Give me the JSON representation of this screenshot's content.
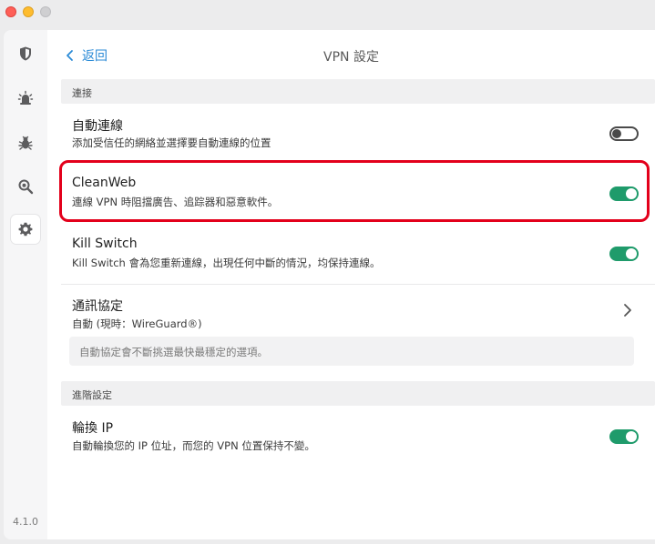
{
  "app": {
    "version": "4.1.0",
    "sidebar": [
      {
        "icon": "shield-icon",
        "active": false
      },
      {
        "icon": "alarm-light-icon",
        "active": false
      },
      {
        "icon": "bug-icon",
        "active": false
      },
      {
        "icon": "search-bug-icon",
        "active": false
      },
      {
        "icon": "gear-icon",
        "active": true
      }
    ]
  },
  "header": {
    "back_label": "返回",
    "title": "VPN 設定"
  },
  "sections": {
    "connect_header": "連接",
    "advanced_header": "進階設定"
  },
  "settings": {
    "auto_connect": {
      "title": "自動連線",
      "subtitle": "添加受信任的網絡並選擇要自動連線的位置",
      "enabled": false
    },
    "cleanweb": {
      "title": "CleanWeb",
      "subtitle": "連線 VPN 時阻擋廣告、追踪器和惡意軟件。",
      "enabled": true
    },
    "kill_switch": {
      "title": "Kill Switch",
      "subtitle": "Kill Switch 會為您重新連線，出現任何中斷的情況，均保持連線。",
      "enabled": true
    },
    "protocol": {
      "title": "通訊協定",
      "subtitle": "自動 (現時：WireGuard®)",
      "info": "自動協定會不斷挑選最快最穩定的選項。"
    },
    "rotating_ip": {
      "title": "輪換 IP",
      "subtitle": "自動輪換您的 IP 位址，而您的 VPN 位置保持不變。",
      "enabled": true
    }
  },
  "colors": {
    "accent": "#2a8ad6",
    "toggle_on": "#1f9b6b",
    "highlight": "#e3001b"
  }
}
